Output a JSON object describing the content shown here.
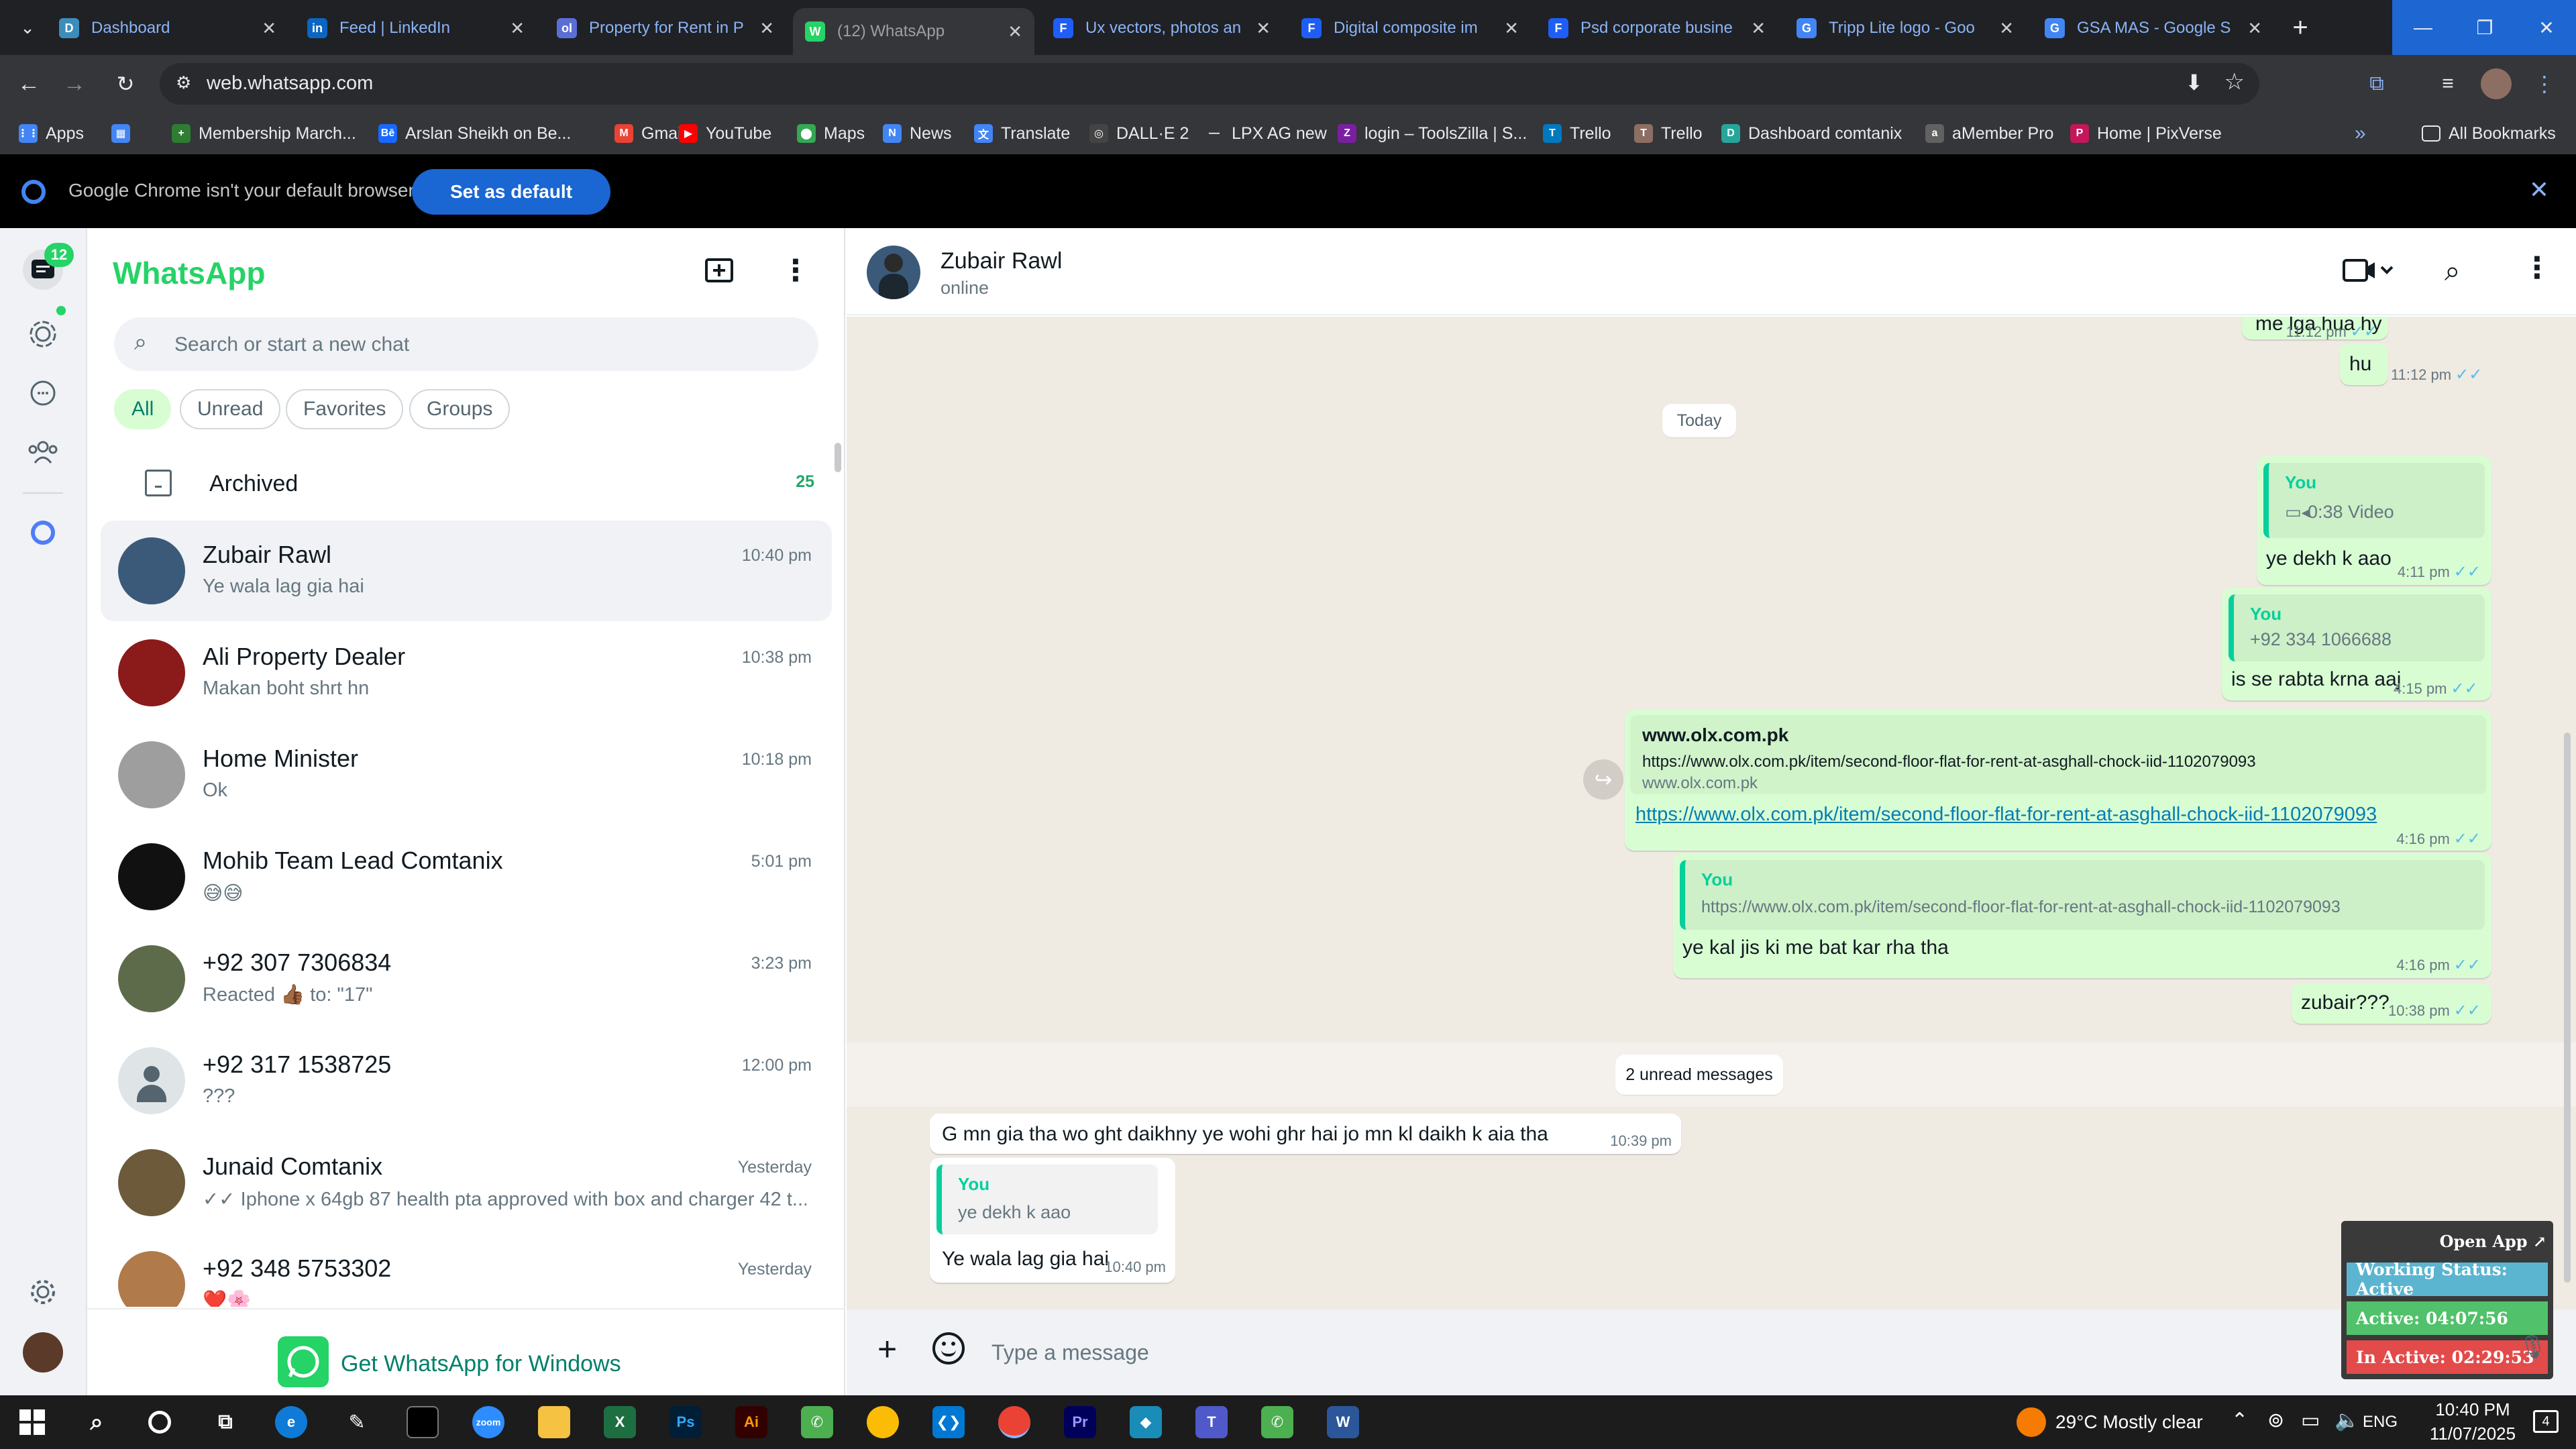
{
  "browser": {
    "tabs": [
      {
        "title": "Dashboard",
        "color": "#3c8dbc",
        "glyph": "D"
      },
      {
        "title": "Feed | LinkedIn",
        "color": "#0a66c2",
        "glyph": "in"
      },
      {
        "title": "Property for Rent in P",
        "color": "#5a6fd6",
        "glyph": "ol"
      },
      {
        "title": "(12) WhatsApp",
        "color": "#25d366",
        "glyph": "W"
      },
      {
        "title": "Ux vectors, photos an",
        "color": "#1e5ef5",
        "glyph": "F"
      },
      {
        "title": "Digital composite im",
        "color": "#1e5ef5",
        "glyph": "F"
      },
      {
        "title": "Psd corporate busine",
        "color": "#1e5ef5",
        "glyph": "F"
      },
      {
        "title": "Tripp Lite logo - Goo",
        "color": "#4285f4",
        "glyph": "G"
      },
      {
        "title": "GSA MAS - Google S",
        "color": "#4285f4",
        "glyph": "G"
      }
    ],
    "url": "web.whatsapp.com",
    "bookmarks": [
      {
        "label": "Apps",
        "color": "#4285f4",
        "glyph": "⋮⋮"
      },
      {
        "label": "",
        "color": "#4285f4",
        "glyph": "▦"
      },
      {
        "label": "Membership March...",
        "color": "#2e7d32",
        "glyph": "+"
      },
      {
        "label": "Arslan Sheikh on Be...",
        "color": "#1769ff",
        "glyph": "Bē"
      },
      {
        "label": "Gmail",
        "color": "#ea4335",
        "glyph": "M"
      },
      {
        "label": "YouTube",
        "color": "#ff0000",
        "glyph": "▶"
      },
      {
        "label": "Maps",
        "color": "#34a853",
        "glyph": "⬤"
      },
      {
        "label": "News",
        "color": "#4285f4",
        "glyph": "N"
      },
      {
        "label": "Translate",
        "color": "#4285f4",
        "glyph": "文"
      },
      {
        "label": "DALL·E 2",
        "color": "#444444",
        "glyph": "◎"
      },
      {
        "label": "LPX AG new",
        "color": "#35363a",
        "glyph": "—"
      },
      {
        "label": "login – ToolsZilla | S...",
        "color": "#7b1fa2",
        "glyph": "Z"
      },
      {
        "label": "Trello",
        "color": "#0079bf",
        "glyph": "T"
      },
      {
        "label": "Trello",
        "color": "#8d6e63",
        "glyph": "T"
      },
      {
        "label": "Dashboard comtanix",
        "color": "#26a69a",
        "glyph": "D"
      },
      {
        "label": "aMember Pro",
        "color": "#616161",
        "glyph": "a"
      },
      {
        "label": "Home | PixVerse",
        "color": "#c2185b",
        "glyph": "P"
      }
    ],
    "all_bookmarks": "All Bookmarks",
    "infobar_message": "Google Chrome isn't your default browser",
    "infobar_button": "Set as default"
  },
  "whatsapp": {
    "unread_badge": "12",
    "title": "WhatsApp",
    "search_placeholder": "Search or start a new chat",
    "filters": [
      "All",
      "Unread",
      "Favorites",
      "Groups"
    ],
    "archived_label": "Archived",
    "archived_count": "25",
    "chats": [
      {
        "name": "Zubair Rawl",
        "preview": "Ye wala lag gia hai",
        "time": "10:40 pm",
        "avatar": "#3b5a7a"
      },
      {
        "name": "Ali Property Dealer",
        "preview": "Makan boht shrt hn",
        "time": "10:38 pm",
        "avatar": "#8b1a1a"
      },
      {
        "name": "Home Minister",
        "preview": "Ok",
        "time": "10:18 pm",
        "avatar": "#9e9e9e"
      },
      {
        "name": "Mohib Team Lead Comtanix",
        "preview": "😅😅",
        "time": "5:01 pm",
        "avatar": "#111111"
      },
      {
        "name": "+92 307 7306834",
        "preview": "Reacted 👍🏾 to: \"17\"",
        "time": "3:23 pm",
        "avatar": "#5d6b4a"
      },
      {
        "name": "+92 317 1538725",
        "preview": "???",
        "time": "12:00 pm",
        "avatar": "#dfe5e7"
      },
      {
        "name": "Junaid Comtanix",
        "preview": "✓✓ Iphone x 64gb 87 health pta approved with box and charger   42 t...",
        "time": "Yesterday",
        "avatar": "#6d5a3a"
      },
      {
        "name": "+92 348 5753302",
        "preview": "❤️🌸",
        "time": "Yesterday",
        "avatar": "#b07a4a"
      }
    ],
    "get_windows": "Get WhatsApp for Windows",
    "contact": {
      "name": "Zubair Rawl",
      "status": "online"
    },
    "messages": {
      "m0_text": "me lga hua hy",
      "m0_time": "11:12 pm",
      "m1_text": "hu",
      "m1_time": "11:12 pm",
      "today": "Today",
      "m2_quote_name": "You",
      "m2_quote_text": "0:38 Video",
      "m2_text": "ye dekh k aao",
      "m2_time": "4:11 pm",
      "m3_quote_name": "You",
      "m3_quote_text": "+92 334 1066688",
      "m3_text": "is se rabta krna aaj",
      "m3_time": "4:15 pm",
      "m4_site_title": "www.olx.com.pk",
      "m4_site_desc": "https://www.olx.com.pk/item/second-floor-flat-for-rent-at-asghall-chock-iid-1102079093",
      "m4_site_domain": "www.olx.com.pk",
      "m4_link": "https://www.olx.com.pk/item/second-floor-flat-for-rent-at-asghall-chock-iid-1102079093",
      "m4_time": "4:16 pm",
      "m5_quote_name": "You",
      "m5_quote_text": "https://www.olx.com.pk/item/second-floor-flat-for-rent-at-asghall-chock-iid-1102079093",
      "m5_text": "ye kal jis ki me bat kar rha tha",
      "m5_time": "4:16 pm",
      "m6_text": "zubair???",
      "m6_time": "10:38 pm",
      "unread_divider": "2 unread messages",
      "m7_text": "G mn gia tha wo ght daikhny ye wohi ghr hai jo mn kl daikh k aia tha",
      "m7_time": "10:39 pm",
      "m8_quote_name": "You",
      "m8_quote_text": "ye dekh k aao",
      "m8_text": "Ye wala lag gia hai",
      "m8_time": "10:40 pm"
    },
    "composer_placeholder": "Type a message"
  },
  "widget": {
    "open_app": "Open App ↗",
    "working_status": "Working Status: Active",
    "active": "Active: 04:07:56",
    "inactive": "In Active: 02:29:53"
  },
  "taskbar": {
    "weather": "29°C  Mostly clear",
    "lang": "ENG",
    "time": "10:40 PM",
    "date": "11/07/2025",
    "notif_count": "4"
  }
}
